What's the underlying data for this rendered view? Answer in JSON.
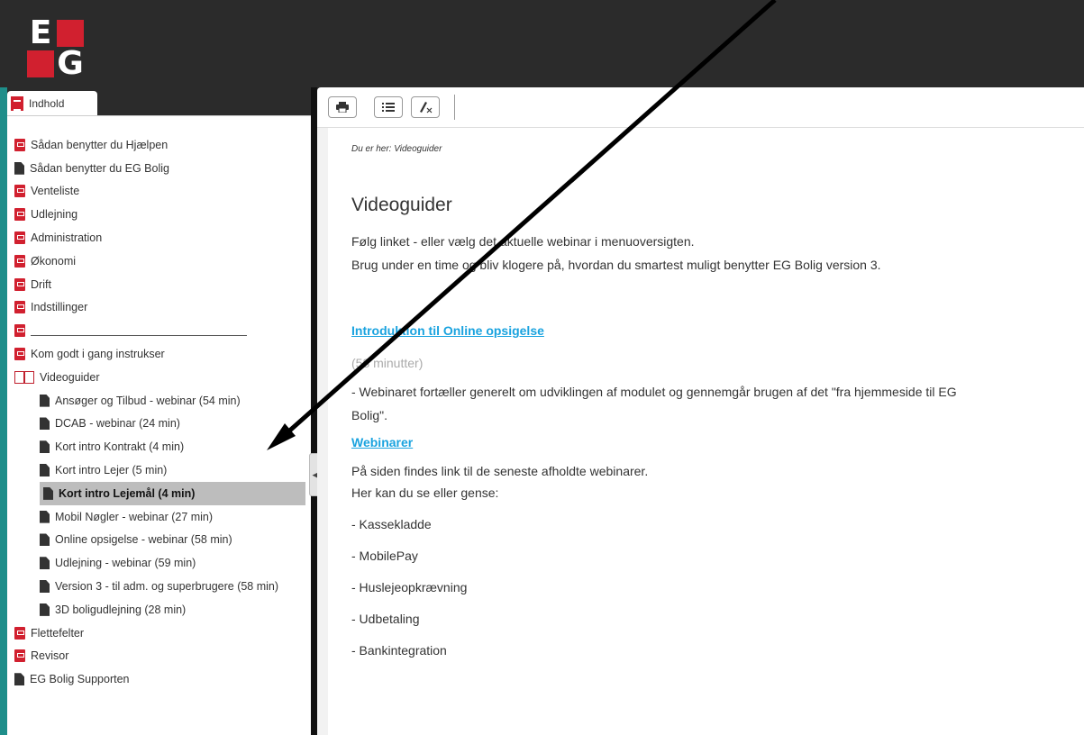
{
  "header": {
    "logo_letters": [
      "E",
      "G"
    ]
  },
  "tabs": [
    {
      "label": "Indhold"
    }
  ],
  "nav": {
    "items": [
      {
        "label": "Sådan benytter du Hjælpen",
        "icon": "book-icon",
        "level": 0
      },
      {
        "label": "Sådan benytter du EG Bolig",
        "icon": "document-icon",
        "level": 0
      },
      {
        "label": "Venteliste",
        "icon": "book-icon",
        "level": 0
      },
      {
        "label": "Udlejning",
        "icon": "book-icon",
        "level": 0
      },
      {
        "label": "Administration",
        "icon": "book-icon",
        "level": 0
      },
      {
        "label": "Økonomi",
        "icon": "book-icon",
        "level": 0
      },
      {
        "label": "Drift",
        "icon": "book-icon",
        "level": 0
      },
      {
        "label": "Indstillinger",
        "icon": "book-icon",
        "level": 0
      },
      {
        "label": "",
        "icon": "book-icon",
        "level": 0,
        "separator": true
      },
      {
        "label": "Kom godt i gang instrukser",
        "icon": "book-icon",
        "level": 0
      },
      {
        "label": "Videoguider",
        "icon": "open-book-icon",
        "level": 0
      },
      {
        "label": "Ansøger og Tilbud - webinar (54 min)",
        "icon": "document-icon",
        "level": 1
      },
      {
        "label": "DCAB - webinar (24 min)",
        "icon": "document-icon",
        "level": 1
      },
      {
        "label": "Kort intro Kontrakt (4 min)",
        "icon": "document-icon",
        "level": 1
      },
      {
        "label": "Kort intro Lejer (5 min)",
        "icon": "document-icon",
        "level": 1
      },
      {
        "label": "Kort intro Lejemål (4 min)",
        "icon": "document-icon",
        "level": 1,
        "selected": true
      },
      {
        "label": "Mobil Nøgler - webinar (27 min)",
        "icon": "document-icon",
        "level": 1
      },
      {
        "label": "Online opsigelse - webinar (58 min)",
        "icon": "document-icon",
        "level": 1
      },
      {
        "label": "Udlejning - webinar (59 min)",
        "icon": "document-icon",
        "level": 1
      },
      {
        "label": "Version 3 - til adm. og superbrugere (58 min)",
        "icon": "document-icon",
        "level": 1
      },
      {
        "label": "3D boligudlejning (28 min)",
        "icon": "document-icon",
        "level": 1
      },
      {
        "label": "Flettefelter",
        "icon": "book-icon",
        "level": 0
      },
      {
        "label": "Revisor",
        "icon": "book-icon",
        "level": 0
      },
      {
        "label": "EG Bolig Supporten",
        "icon": "document-icon",
        "level": 0
      }
    ]
  },
  "toolbar": {
    "buttons": [
      {
        "icon": "print-icon"
      },
      {
        "icon": "list-icon"
      },
      {
        "icon": "clear-highlight-icon"
      }
    ]
  },
  "content": {
    "breadcrumb": "Du er her: Videoguider",
    "title": "Videoguider",
    "intro_line1": "Følg linket - eller vælg det aktuelle webinar i menuoversigten.",
    "intro_line2": "Brug under en time og bliv klogere på, hvordan du smartest muligt benytter EG Bolig version 3.",
    "link1": "Introduktion til Online opsigelse",
    "duration1": "(58 minutter)",
    "desc1_line1": "- Webinaret fortæller generelt om udviklingen af modulet og gennemgår brugen af det \"fra hjemmeside til EG",
    "desc1_line2": "Bolig\".",
    "link2": "Webinarer",
    "desc2_line1": "På siden findes link til de seneste afholdte webinarer.",
    "desc2_line2": "Her kan du se eller gense:",
    "bullets": [
      "- Kassekladde",
      "- MobilePay",
      "- Huslejeopkrævning",
      "- Udbetaling",
      "- Bankintegration"
    ]
  },
  "colors": {
    "brand_red": "#d1202f",
    "link_blue": "#1aa3df",
    "selected_bg": "#bdbdbd",
    "teal": "#1e8e8a"
  }
}
